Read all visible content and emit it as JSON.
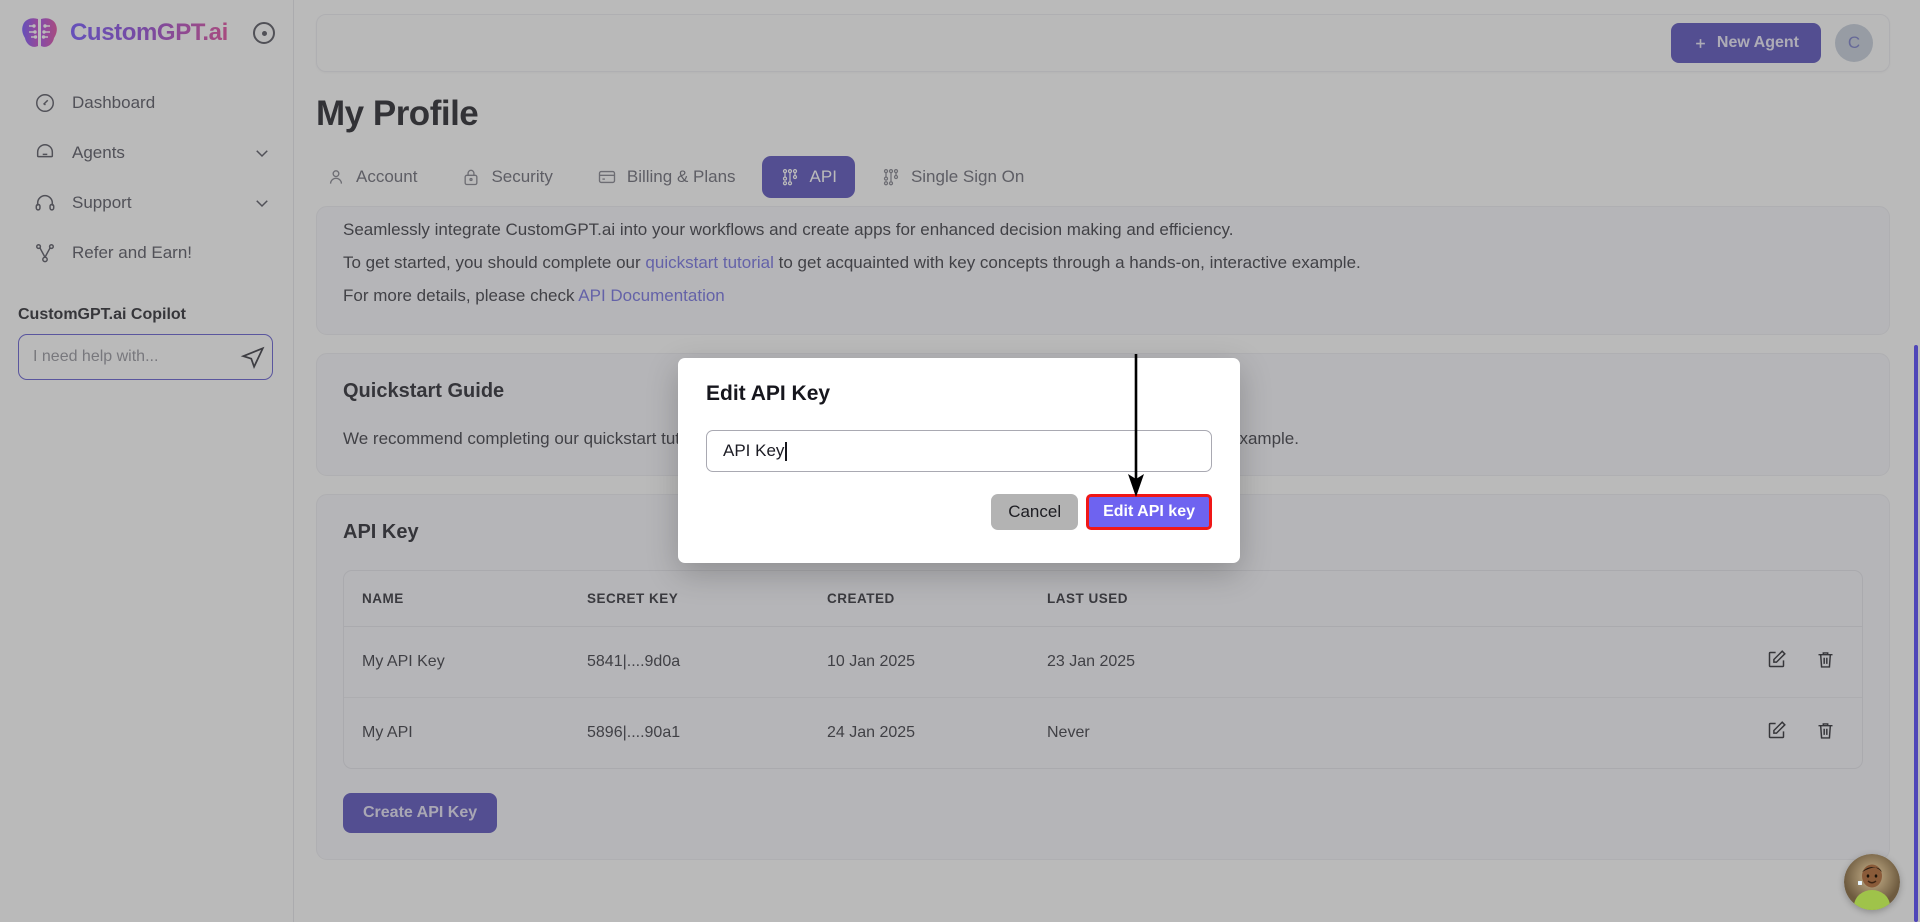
{
  "brand": {
    "name": "CustomGPT.ai",
    "collapse_icon": "collapse-circle-icon"
  },
  "sidebar": {
    "items": [
      {
        "label": "Dashboard",
        "icon": "speedometer-icon",
        "expandable": false
      },
      {
        "label": "Agents",
        "icon": "chat-bubble-icon",
        "expandable": true
      },
      {
        "label": "Support",
        "icon": "headset-icon",
        "expandable": true
      },
      {
        "label": "Refer and Earn!",
        "icon": "share-nodes-icon",
        "expandable": false
      }
    ],
    "copilot": {
      "title": "CustomGPT.ai Copilot",
      "input_placeholder": "I need help with...",
      "input_value": "",
      "send_icon": "paper-plane-icon"
    }
  },
  "topbar": {
    "new_agent_label": "New Agent",
    "new_agent_icon": "plus-icon",
    "avatar_initial": "C"
  },
  "page": {
    "title": "My Profile"
  },
  "tabs": [
    {
      "label": "Account",
      "icon": "user-icon",
      "active": false
    },
    {
      "label": "Security",
      "icon": "lock-icon",
      "active": false
    },
    {
      "label": "Billing & Plans",
      "icon": "credit-card-icon",
      "active": false
    },
    {
      "label": "API",
      "icon": "api-nodes-icon",
      "active": true
    },
    {
      "label": "Single Sign On",
      "icon": "api-nodes-icon",
      "active": false
    }
  ],
  "intro": {
    "line1": "Seamlessly integrate CustomGPT.ai into your workflows and create apps for enhanced decision making and efficiency.",
    "line2_pre": "To get started, you should complete our ",
    "line2_link": "quickstart tutorial",
    "line2_post": " to get acquainted with key concepts through a hands-on, interactive example.",
    "line3_pre": "For more details, please check ",
    "line3_link": "API Documentation"
  },
  "quickstart": {
    "heading": "Quickstart Guide",
    "body": "We recommend completing our quickstart tutorial to get acquainted with key concepts through a hands-on, interactive example."
  },
  "api_key_section": {
    "heading": "API Key",
    "columns": [
      "NAME",
      "SECRET KEY",
      "CREATED",
      "LAST USED"
    ],
    "rows": [
      {
        "name": "My API Key",
        "secret": "5841|....9d0a",
        "created": "10 Jan 2025",
        "last_used": "23 Jan 2025",
        "edit_icon": "edit-pencil-icon",
        "delete_icon": "trash-icon"
      },
      {
        "name": "My API",
        "secret": "5896|....90a1",
        "created": "24 Jan 2025",
        "last_used": "Never",
        "edit_icon": "edit-pencil-icon",
        "delete_icon": "trash-icon"
      }
    ],
    "create_button": "Create API Key"
  },
  "modal": {
    "title": "Edit API Key",
    "input_value": "API Key",
    "cancel_label": "Cancel",
    "submit_label": "Edit API key"
  },
  "colors": {
    "brand_purple": "#4f46b8",
    "accent_violet": "#6e63f0",
    "link_blue": "#6b68e0",
    "highlight_red": "#f01717",
    "scrollbar": "#4f46b8"
  }
}
